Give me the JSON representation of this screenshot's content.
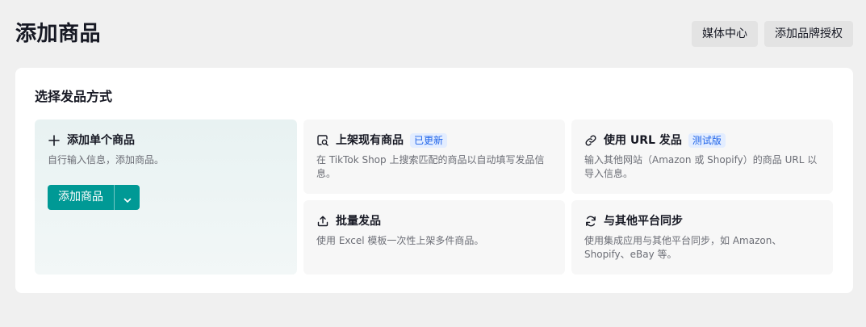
{
  "header": {
    "title": "添加商品",
    "actions": {
      "media_center": "媒体中心",
      "add_brand_auth": "添加品牌授权"
    }
  },
  "panel": {
    "title": "选择发品方式",
    "cards": {
      "single": {
        "icon": "plus-icon",
        "title": "添加单个商品",
        "desc": "自行输入信息，添加商品。",
        "button_label": "添加商品"
      },
      "existing": {
        "icon": "search-listing-icon",
        "title": "上架现有商品",
        "badge": "已更新",
        "desc": "在 TikTok Shop 上搜索匹配的商品以自动填写发品信息。"
      },
      "url": {
        "icon": "link-icon",
        "title": "使用 URL 发品",
        "badge": "测试版",
        "desc": "输入其他网站（Amazon 或 Shopify）的商品 URL 以导入信息。"
      },
      "bulk": {
        "icon": "upload-icon",
        "title": "批量发品",
        "desc": "使用 Excel 模板一次性上架多件商品。"
      },
      "sync": {
        "icon": "sync-icon",
        "title": "与其他平台同步",
        "desc": "使用集成应用与其他平台同步，如 Amazon、Shopify、eBay 等。"
      }
    }
  },
  "colors": {
    "primary": "#009995",
    "badge_bg": "#e3edff",
    "badge_text": "#1e63e9",
    "page_bg": "#f0f0f0"
  }
}
